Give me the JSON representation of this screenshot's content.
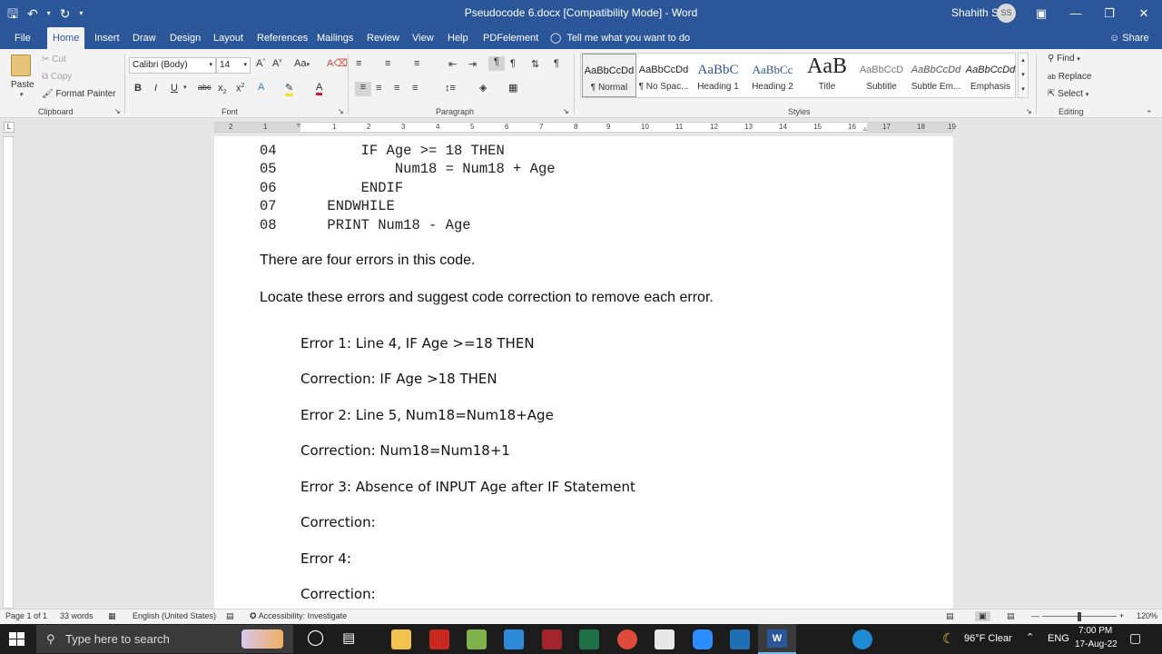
{
  "titlebar": {
    "document_title": "Pseudocode 6.docx [Compatibility Mode]  -  Word",
    "user_name": "Shahith S",
    "user_initials": "SS",
    "accent": "#2b579a"
  },
  "tabs": [
    "File",
    "Home",
    "Insert",
    "Draw",
    "Design",
    "Layout",
    "References",
    "Mailings",
    "Review",
    "View",
    "Help",
    "PDFelement"
  ],
  "active_tab": "Home",
  "tell_me": "Tell me what you want to do",
  "share": "Share",
  "clipboard": {
    "paste": "Paste",
    "cut": "Cut",
    "copy": "Copy",
    "format_painter": "Format Painter",
    "label": "Clipboard"
  },
  "font": {
    "family": "Calibri (Body)",
    "size": "14",
    "label": "Font"
  },
  "paragraph": {
    "label": "Paragraph"
  },
  "styles": {
    "label": "Styles",
    "items": [
      {
        "preview": "AaBbCcDd",
        "name": "¶ Normal"
      },
      {
        "preview": "AaBbCcDd",
        "name": "¶ No Spac..."
      },
      {
        "preview": "AaBbC",
        "name": "Heading 1"
      },
      {
        "preview": "AaBbCc",
        "name": "Heading 2"
      },
      {
        "preview": "AaB",
        "name": "Title"
      },
      {
        "preview": "AaBbCcD",
        "name": "Subtitle"
      },
      {
        "preview": "AaBbCcDd",
        "name": "Subtle Em..."
      },
      {
        "preview": "AaBbCcDd",
        "name": "Emphasis"
      }
    ]
  },
  "editing": {
    "find": "Find",
    "replace": "Replace",
    "select": "Select",
    "label": "Editing"
  },
  "ruler_numbers": [
    "2",
    "1",
    "1",
    "2",
    "3",
    "4",
    "5",
    "6",
    "7",
    "8",
    "9",
    "10",
    "11",
    "12",
    "13",
    "14",
    "15",
    "16",
    "17",
    "18",
    "19"
  ],
  "document": {
    "code_lines": [
      {
        "num": "04",
        "text": "        IF Age >= 18 THEN"
      },
      {
        "num": "05",
        "text": "            Num18 = Num18 + Age"
      },
      {
        "num": "06",
        "text": "        ENDIF"
      },
      {
        "num": "07",
        "text": "    ENDWHILE"
      },
      {
        "num": "08",
        "text": "    PRINT Num18 - Age"
      }
    ],
    "para1": "There are four errors in this code.",
    "para2": "Locate these errors and suggest code correction to remove each error.",
    "answers": [
      "Error 1: Line 4, IF Age >=18 THEN",
      "Correction: IF Age >18 THEN",
      "Error 2: Line 5, Num18=Num18+Age",
      "Correction: Num18=Num18+1",
      "Error 3: Absence of INPUT Age after IF Statement",
      "Correction:",
      "Error 4:",
      "Correction:"
    ]
  },
  "statusbar": {
    "page": "Page 1 of 1",
    "words": "33 words",
    "language": "English (United States)",
    "accessibility": "Accessibility: Investigate",
    "zoom": "120%"
  },
  "taskbar": {
    "search_placeholder": "Type here to search",
    "weather": "96°F  Clear",
    "language": "ENG",
    "time": "7:00 PM",
    "date": "17-Aug-22"
  }
}
